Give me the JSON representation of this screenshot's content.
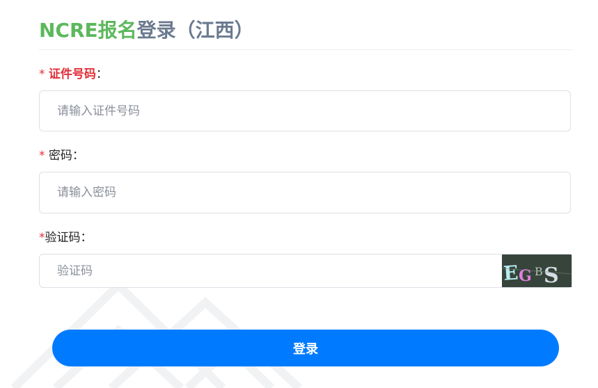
{
  "title": {
    "part1": "NCRE报名",
    "part2": "登录（江西）"
  },
  "fields": {
    "id_number": {
      "star": "* ",
      "label": "证件号码",
      "colon": "：",
      "placeholder": "请输入证件号码"
    },
    "password": {
      "star": "* ",
      "label": "密码",
      "colon": "：",
      "placeholder": "请输入密码"
    },
    "captcha": {
      "star": "*",
      "label": "验证码",
      "colon": "：",
      "placeholder": "验证码",
      "image_text": "EGBS"
    }
  },
  "login_button": "登录",
  "colors": {
    "title_green": "#5cb85c",
    "title_gray": "#6b7a8f",
    "required_red": "#e0303a",
    "primary_blue": "#007bff"
  }
}
